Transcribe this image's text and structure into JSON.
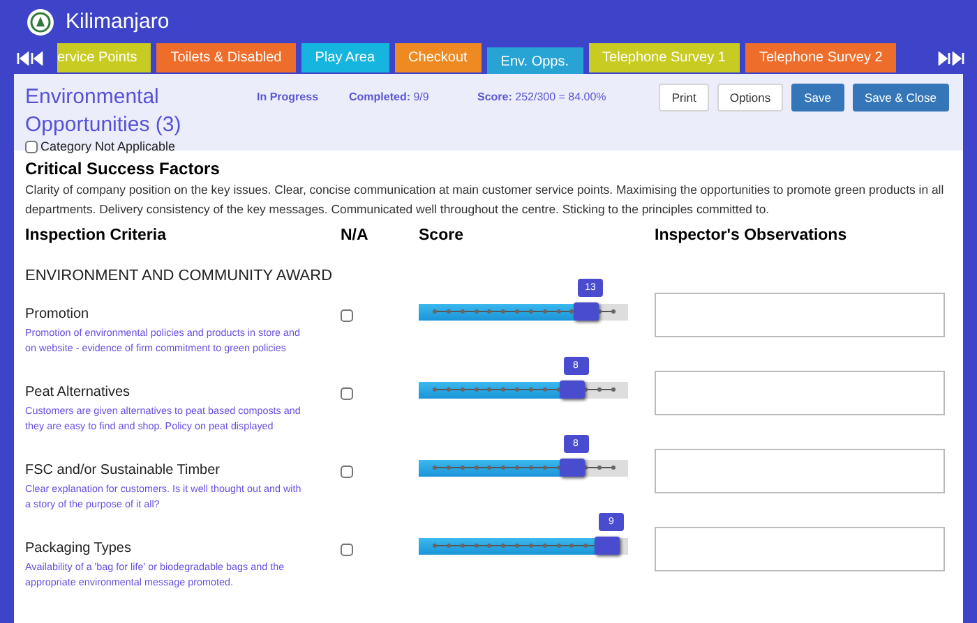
{
  "header": {
    "title": "Kilimanjaro"
  },
  "tabs": [
    {
      "label": "ervice Points",
      "color": "#c8cc22",
      "selected": false
    },
    {
      "label": "Toilets & Disabled",
      "color": "#ee6d2a",
      "selected": false
    },
    {
      "label": "Play Area",
      "color": "#16b5e0",
      "selected": false
    },
    {
      "label": "Checkout",
      "color": "#ef8a22",
      "selected": false
    },
    {
      "label": "Env. Opps.",
      "color": "#27a3d4",
      "selected": true
    },
    {
      "label": "Telephone Survey 1",
      "color": "#c8cc22",
      "selected": false
    },
    {
      "label": "Telephone Survey 2",
      "color": "#ee6d2a",
      "selected": false
    }
  ],
  "category": {
    "title": "Environmental Opportunities (3)",
    "status": "In Progress",
    "completed_label": "Completed:",
    "completed": "9/9",
    "score_label": "Score:",
    "score": "252/300 = 84.00%",
    "not_applicable": {
      "label": "Category Not Applicable",
      "checked": false
    }
  },
  "buttons": [
    {
      "label": "Print",
      "kind": "plain"
    },
    {
      "label": "Options",
      "kind": "plain"
    },
    {
      "label": "Save",
      "kind": "primary"
    },
    {
      "label": "Save & Close",
      "kind": "primary"
    }
  ],
  "csf": {
    "title": "Critical Success Factors",
    "text": "Clarity of company position on the key issues. Clear, concise communication at main customer service points. Maximising the opportunities to promote green products in all departments. Delivery consistency of the key messages. Communicated well throughout the centre. Sticking to the principles committed to."
  },
  "columns": [
    "Inspection Criteria",
    "N/A",
    "Score",
    "Inspector's Observations"
  ],
  "section": "ENVIRONMENT AND COMMUNITY AWARD",
  "criteria": [
    {
      "name": "Promotion",
      "description": "Promotion of environmental policies and products in store and on website - evidence of firm commitment to green policies",
      "na": false,
      "level": 0.82,
      "reading": "13"
    },
    {
      "name": "Peat Alternatives",
      "description": "Customers are given alternatives to peat based composts and they are easy to find and shop. Policy on peat displayed",
      "na": false,
      "level": 0.75,
      "reading": "8"
    },
    {
      "name": "FSC and/or Sustainable Timber",
      "description": "Clear explanation for customers. Is it well thought out and with a story of the purpose of it all?",
      "na": false,
      "level": 0.75,
      "reading": "8"
    },
    {
      "name": "Packaging Types",
      "description": "Availability of a 'bag for life' or biodegradable bags and the appropriate environmental message promoted.",
      "na": false,
      "level": 0.92,
      "reading": "9"
    }
  ]
}
